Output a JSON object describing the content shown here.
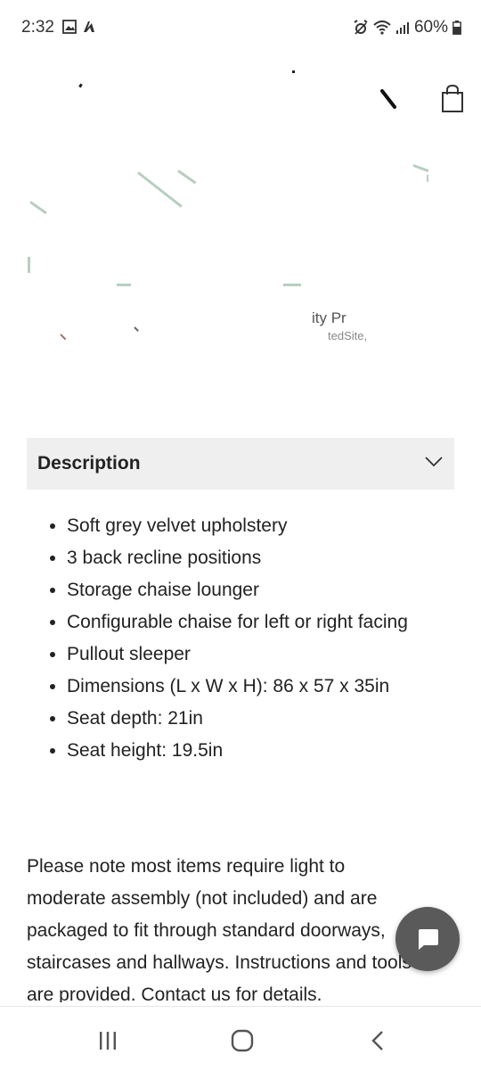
{
  "status_bar": {
    "time": "2:32",
    "battery": "60%",
    "icons_left": [
      "image-icon",
      "app-notification-icon"
    ],
    "icons_right": [
      "alarm-icon",
      "wifi-icon",
      "signal-icon",
      "battery-icon"
    ]
  },
  "header": {
    "icons": [
      "search-icon",
      "shopping-bag-icon"
    ]
  },
  "hero": {
    "fragment_text": "ity Pr",
    "fragment_sub": "tedSite,"
  },
  "description": {
    "title": "Description",
    "items": [
      "Soft grey velvet upholstery",
      "3 back recline positions",
      "Storage chaise lounger",
      "Configurable chaise for left or right facing",
      "Pullout sleeper",
      "Dimensions (L x W x H): 86 x 57 x 35in",
      "Seat depth: 21in",
      "Seat height: 19.5in"
    ]
  },
  "note": "Please note most items require light to moderate assembly (not included) and are packaged to fit through standard doorways, staircases and hallways. Instructions and tools are provided. Contact us for details.",
  "chat": {
    "icon": "chat-bubble-icon"
  },
  "nav": {
    "icons": [
      "recent-apps-icon",
      "home-icon",
      "back-icon"
    ]
  },
  "colors": {
    "accordion_bg": "#efefef",
    "fab_bg": "#5a5a5a",
    "text": "#222222"
  }
}
